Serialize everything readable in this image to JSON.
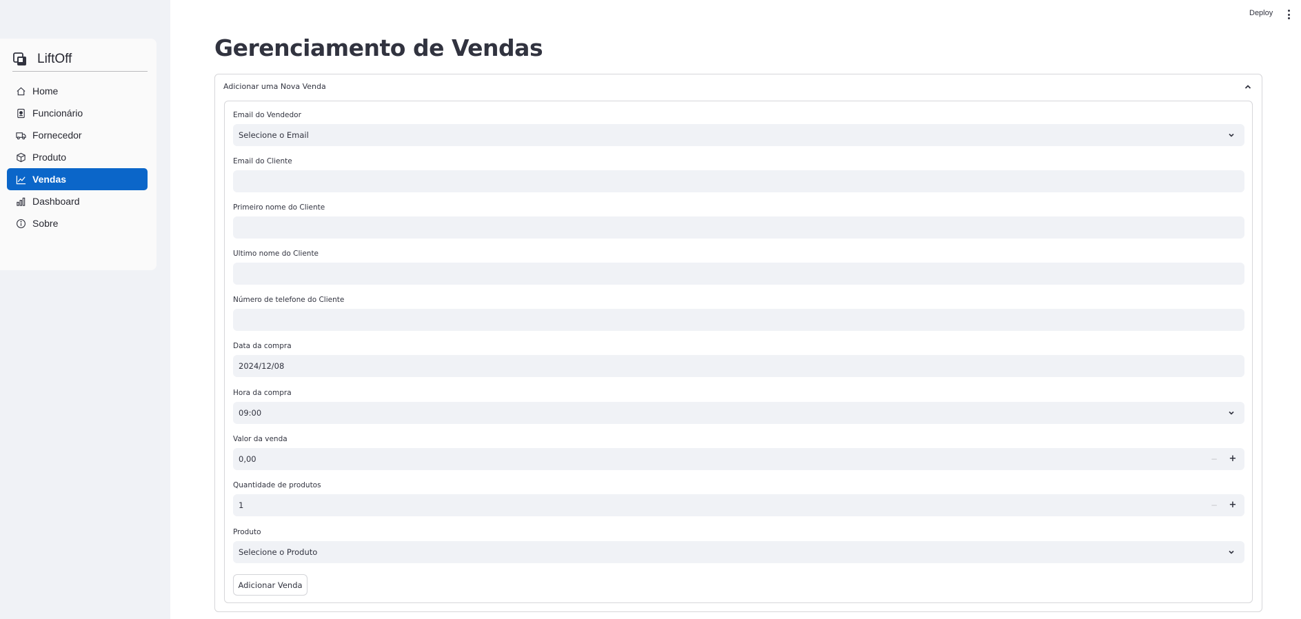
{
  "header": {
    "deploy_label": "Deploy"
  },
  "sidebar": {
    "brand": "LiftOff",
    "items": [
      {
        "label": "Home",
        "icon": "home-icon",
        "active": false
      },
      {
        "label": "Funcionário",
        "icon": "badge-icon",
        "active": false
      },
      {
        "label": "Fornecedor",
        "icon": "truck-icon",
        "active": false
      },
      {
        "label": "Produto",
        "icon": "box-icon",
        "active": false
      },
      {
        "label": "Vendas",
        "icon": "line-chart-icon",
        "active": true
      },
      {
        "label": "Dashboard",
        "icon": "bar-chart-icon",
        "active": false
      },
      {
        "label": "Sobre",
        "icon": "info-icon",
        "active": false
      }
    ]
  },
  "main": {
    "title": "Gerenciamento de Vendas",
    "expander": {
      "label": "Adicionar uma Nova Venda",
      "expanded": true
    },
    "form": {
      "seller_email": {
        "label": "Email do Vendedor",
        "value": "Selecione o Email"
      },
      "client_email": {
        "label": "Email do Cliente",
        "value": ""
      },
      "client_first_name": {
        "label": "Primeiro nome do Cliente",
        "value": ""
      },
      "client_last_name": {
        "label": "Ultimo nome do Cliente",
        "value": ""
      },
      "client_phone": {
        "label": "Número de telefone do Cliente",
        "value": ""
      },
      "purchase_date": {
        "label": "Data da compra",
        "value": "2024/12/08"
      },
      "purchase_time": {
        "label": "Hora da compra",
        "value": "09:00"
      },
      "sale_value": {
        "label": "Valor da venda",
        "value": "0,00",
        "minus": "−",
        "plus": "+"
      },
      "quantity": {
        "label": "Quantidade de produtos",
        "value": "1",
        "minus": "−",
        "plus": "+"
      },
      "product": {
        "label": "Produto",
        "value": "Selecione o Produto"
      },
      "submit_label": "Adicionar Venda"
    }
  },
  "colors": {
    "accent": "#0b66c9",
    "sidebar_bg": "#f0f2f6",
    "input_bg": "#f0f2f6",
    "text": "#31333f"
  }
}
